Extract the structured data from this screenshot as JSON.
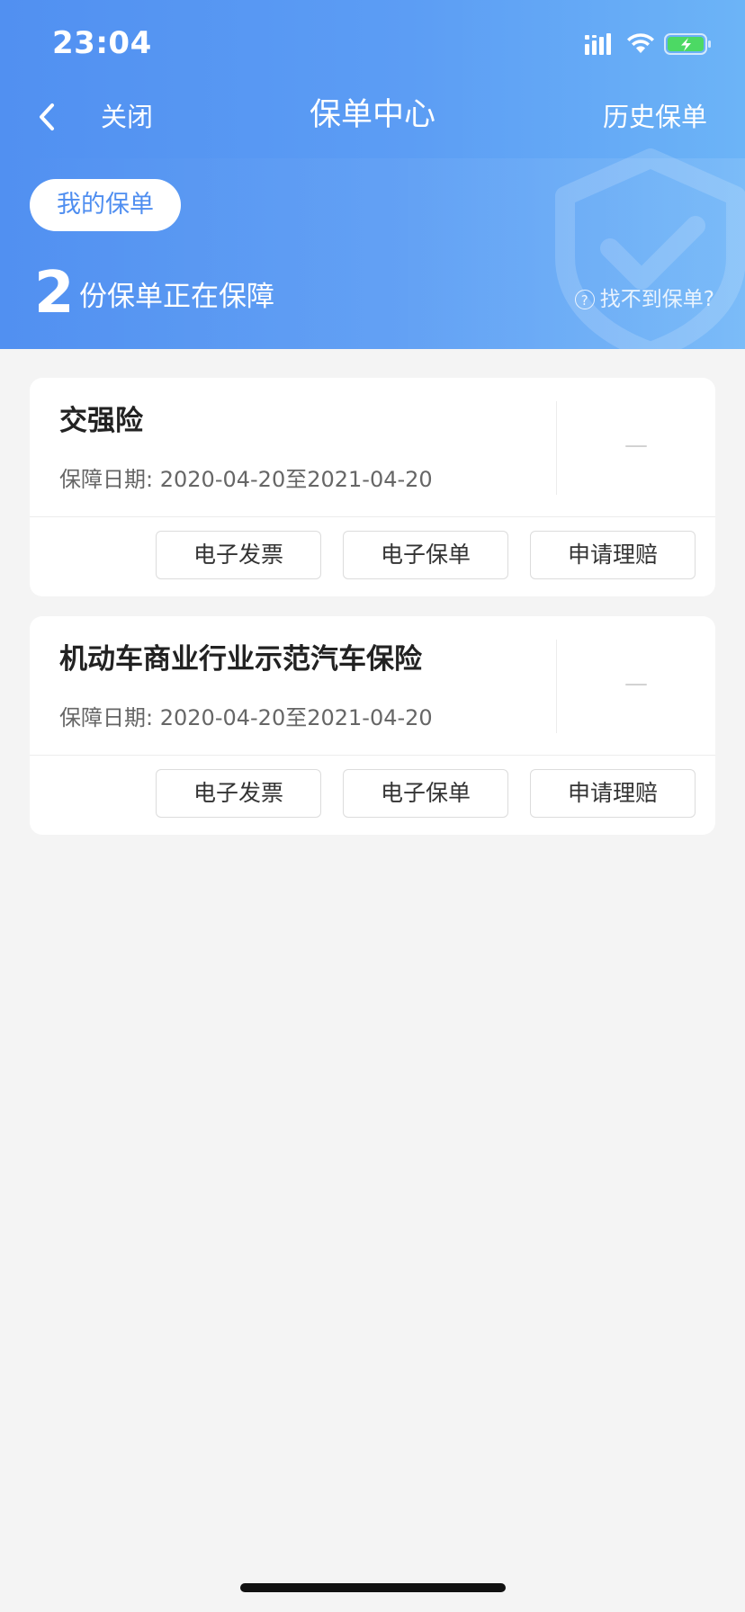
{
  "status_bar": {
    "time": "23:04"
  },
  "nav": {
    "close_label": "关闭",
    "title": "保单中心",
    "history_label": "历史保单"
  },
  "summary": {
    "tab_label": "我的保单",
    "count": "2",
    "count_label": "份保单正在保障",
    "help_label": "找不到保单?"
  },
  "policies": [
    {
      "name": "交强险",
      "date_prefix": "保障日期:",
      "date_range": "2020-04-20至2021-04-20",
      "status": "—",
      "actions": [
        "电子发票",
        "电子保单",
        "申请理赔"
      ]
    },
    {
      "name": "机动车商业行业示范汽车保险",
      "date_prefix": "保障日期:",
      "date_range": "2020-04-20至2021-04-20",
      "status": "—",
      "actions": [
        "电子发票",
        "电子保单",
        "申请理赔"
      ]
    }
  ],
  "colors": {
    "header_gradient_start": "#5190f1",
    "header_gradient_end": "#6cb4f7",
    "accent_blue": "#4f8ef0",
    "background": "#f4f4f4"
  },
  "icons": {
    "back": "chevron-left-icon",
    "signal": "signal-icon",
    "wifi": "wifi-icon",
    "battery": "battery-charging-icon",
    "help": "question-circle-icon",
    "watermark": "shield-check-icon"
  }
}
